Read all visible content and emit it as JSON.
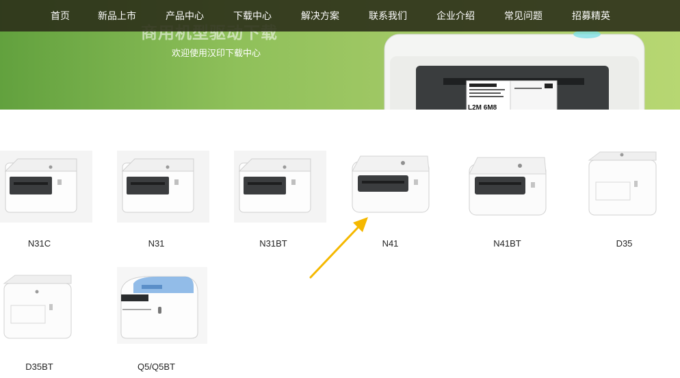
{
  "nav": {
    "items": [
      {
        "label": "首页",
        "name": "nav-item-home"
      },
      {
        "label": "新品上市",
        "name": "nav-item-new-products"
      },
      {
        "label": "产品中心",
        "name": "nav-item-products"
      },
      {
        "label": "下载中心",
        "name": "nav-item-downloads"
      },
      {
        "label": "解决方案",
        "name": "nav-item-solutions"
      },
      {
        "label": "联系我们",
        "name": "nav-item-contact"
      },
      {
        "label": "企业介绍",
        "name": "nav-item-about"
      },
      {
        "label": "常见问题",
        "name": "nav-item-faq"
      },
      {
        "label": "招募精英",
        "name": "nav-item-careers"
      }
    ]
  },
  "banner": {
    "title": "商用机型驱动下载",
    "subtitle": "欢迎使用汉印下载中心",
    "label_text": "L2M 6M8"
  },
  "products": [
    {
      "label": "N31C",
      "style": "wide"
    },
    {
      "label": "N31",
      "style": "wide"
    },
    {
      "label": "N31BT",
      "style": "wide"
    },
    {
      "label": "N41",
      "style": "wide"
    },
    {
      "label": "N41BT",
      "style": "wide"
    },
    {
      "label": "D35",
      "style": "cube"
    },
    {
      "label": "D35BT",
      "style": "cube"
    },
    {
      "label": "Q5/Q5BT",
      "style": "blue"
    }
  ],
  "colors": {
    "nav_bg": "#2c301a",
    "banner_green": "#8fc05a",
    "arrow": "#f5b800"
  }
}
